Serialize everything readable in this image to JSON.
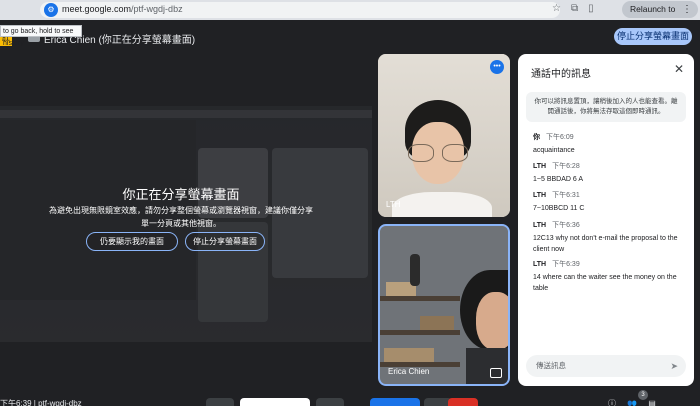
{
  "browser": {
    "url_host": "meet.google.com",
    "url_path": "/ptf-wgdj-dbz",
    "relaunch_label": "Relaunch to update",
    "tooltip": "to go back, hold to see history"
  },
  "banner": {
    "presenter_title": "Erica Chien (你正在分享螢幕畫面)",
    "stop_sharing_label": "停止分享螢幕畫面",
    "avatar_letter": "肛"
  },
  "share": {
    "title": "你正在分享螢幕畫面",
    "description": "為避免出現無限鏡室效應，請勿分享整個螢幕或瀏覽器視窗，建議你僅分享單一分頁或其他視窗。",
    "show_button": "仍要顯示我的畫面",
    "stop_button": "停止分享螢幕畫面"
  },
  "participants": [
    {
      "name": "LTH"
    },
    {
      "name": "Erica Chien"
    }
  ],
  "chat": {
    "title": "通話中的訊息",
    "notice": "你可以將訊息置頂，讓稍後加入的人也能查看。離開通話後，你將無法存取這個即時通訊。",
    "messages": [
      {
        "sender": "你",
        "time": "下午6:09",
        "text": "acquaintance"
      },
      {
        "sender": "LTH",
        "time": "下午6:28",
        "text": "1~5 BBDAD  6 A"
      },
      {
        "sender": "LTH",
        "time": "下午6:31",
        "text": "7~10BBCD  11 C"
      },
      {
        "sender": "LTH",
        "time": "下午6:36",
        "text": "12C13 why not don't e-mail the proposal to the client now"
      },
      {
        "sender": "LTH",
        "time": "下午6:39",
        "text": "14 where can the waiter see the money  on the table"
      }
    ],
    "input_placeholder": "傳送訊息"
  },
  "toolbar": {
    "meeting_info": "下午6:39  |  ptf-wgdj-dbz",
    "participant_count": "3"
  },
  "colors": {
    "meet_bg": "#202124",
    "accent": "#a8c7fa",
    "active_border": "#8ab4f8",
    "hangup": "#d93025"
  }
}
